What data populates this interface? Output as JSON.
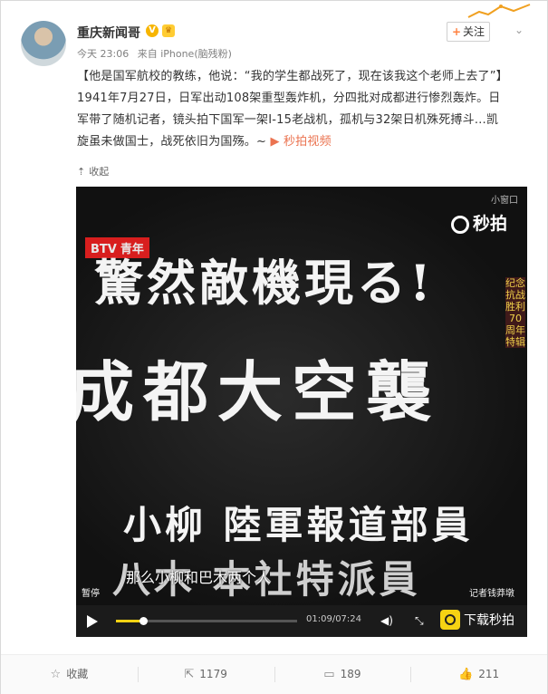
{
  "author": {
    "name": "重庆新闻哥",
    "badge": "V",
    "medal": "♛"
  },
  "meta": {
    "time": "今天 23:06",
    "source": "来自 iPhone(脑残粉)"
  },
  "follow_button": {
    "plus": "+",
    "label": "关注"
  },
  "post": {
    "line1": "【他是国军航校的教练，他说：“我的学生都战死了，现在该我这个老师上去了”】1941年7月27日，日军出动108架重型轰炸机，分四批对成都进行惨烈轰炸。日军带了随机记者，镜头拍下国军一架I-15老战机，孤机与32架日机殊死搏斗…凯旋虽未做国士，战死依旧为国殇。~",
    "video_link": "秒拍视频"
  },
  "collapse": {
    "label": "收起"
  },
  "video": {
    "small_window": "小窗口",
    "brand": "秒拍",
    "channel": "BTV",
    "channel_sub": "青年",
    "caption1": "驚然敵機現る!",
    "caption2": "成都大空襲",
    "caption3": "小柳 陸軍報道部員",
    "caption4": "八木 本社特派員",
    "side_text": "纪念抗战胜利70周年特辑",
    "subtitle": "那么小柳和巴木两个人",
    "pause_label": "暂停",
    "reporter": "记者钱莽墩",
    "time": "01:09/07:24",
    "progress_percent": 15,
    "download": "下载秒拍"
  },
  "actions": [
    {
      "icon": "☆",
      "label": "收藏"
    },
    {
      "icon": "⇱",
      "label": "1179"
    },
    {
      "icon": "▭",
      "label": "189"
    },
    {
      "icon": "👍",
      "label": "211"
    }
  ]
}
